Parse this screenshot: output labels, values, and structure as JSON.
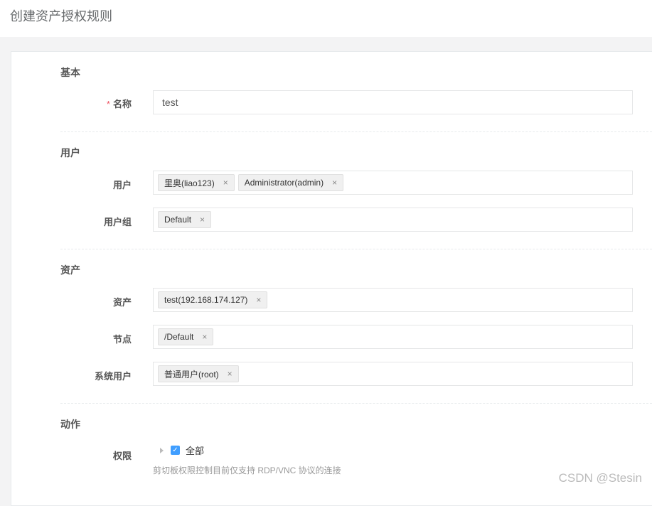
{
  "title": "创建资产授权规则",
  "sections": {
    "basic": "基本",
    "user": "用户",
    "asset": "资产",
    "action": "动作"
  },
  "fields": {
    "name": {
      "label": "名称",
      "required": "*",
      "value": "test"
    },
    "users": {
      "label": "用户",
      "tags": [
        "里奥(liao123)",
        "Administrator(admin)"
      ]
    },
    "user_groups": {
      "label": "用户组",
      "tags": [
        "Default"
      ]
    },
    "assets": {
      "label": "资产",
      "tags": [
        "test(192.168.174.127)"
      ]
    },
    "nodes": {
      "label": "节点",
      "tags": [
        "/Default"
      ]
    },
    "system_users": {
      "label": "系统用户",
      "tags": [
        "普通用户(root)"
      ]
    },
    "permissions": {
      "label": "权限",
      "option": "全部",
      "checked": true,
      "help": "剪切板权限控制目前仅支持 RDP/VNC 协议的连接"
    }
  },
  "remove_glyph": "×",
  "check_glyph": "✓",
  "watermark": "CSDN @Stesin"
}
